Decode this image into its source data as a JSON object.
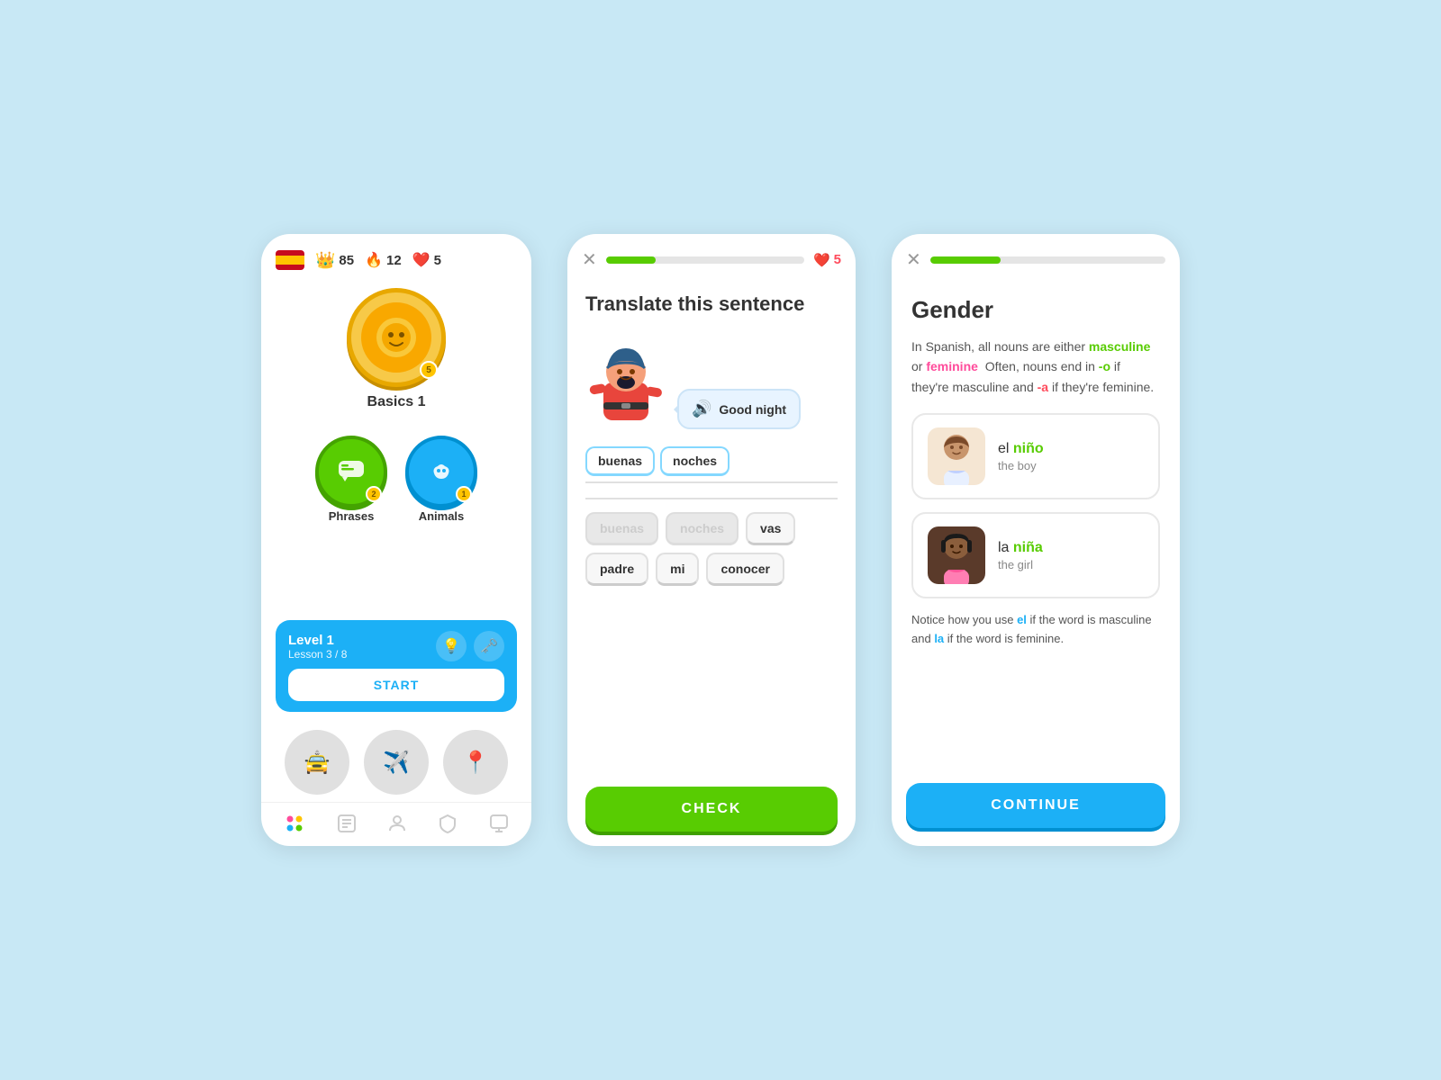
{
  "bg_color": "#c8e8f5",
  "card1": {
    "flag": "🇪🇸",
    "stats": {
      "crown_icon": "👑",
      "crown_value": "85",
      "fire_icon": "🔥",
      "fire_value": "12",
      "heart_icon": "❤️",
      "heart_value": "5"
    },
    "basics": {
      "icon": "⭐",
      "badge": "5",
      "label": "Basics 1"
    },
    "phrases": {
      "icon": "💬",
      "badge": "2",
      "label": "Phrases"
    },
    "animals": {
      "icon": "🐟",
      "badge": "1",
      "label": "Animals"
    },
    "level": {
      "title": "Level 1",
      "lesson": "Lesson 3 / 8",
      "start_label": "START"
    },
    "locked": [
      "🚖",
      "✈️",
      "📍"
    ],
    "nav_items": [
      "home",
      "book",
      "globe",
      "shield",
      "id"
    ]
  },
  "card2": {
    "progress_pct": 25,
    "lives": "5",
    "title": "Translate this sentence",
    "speech_text": "Good night",
    "answer_words": [
      "buenas",
      "noches"
    ],
    "word_bank": [
      {
        "text": "buenas",
        "used": true
      },
      {
        "text": "noches",
        "used": true
      },
      {
        "text": "vas",
        "used": false
      },
      {
        "text": "padre",
        "used": false
      },
      {
        "text": "mi",
        "used": false
      },
      {
        "text": "conocer",
        "used": false
      }
    ],
    "check_label": "CHECK"
  },
  "card3": {
    "progress_pct": 30,
    "title": "Gender",
    "description_parts": [
      {
        "text": "In Spanish, all nouns are either ",
        "style": "normal"
      },
      {
        "text": "masculine",
        "style": "green"
      },
      {
        "text": " or ",
        "style": "normal"
      },
      {
        "text": "feminine",
        "style": "pink"
      },
      {
        "text": "  Often, nouns end in ",
        "style": "normal"
      },
      {
        "text": "-o",
        "style": "green"
      },
      {
        "text": " if they're masculine and ",
        "style": "normal"
      },
      {
        "text": "-a",
        "style": "red"
      },
      {
        "text": " if they're feminine.",
        "style": "normal"
      }
    ],
    "boy_card": {
      "article": "el ",
      "word": "niño",
      "translation": "the boy"
    },
    "girl_card": {
      "article": "la ",
      "word": "niña",
      "translation": "the girl"
    },
    "note_parts": [
      {
        "text": "Notice how you use ",
        "style": "normal"
      },
      {
        "text": "el",
        "style": "blue"
      },
      {
        "text": " if the word is masculine and ",
        "style": "normal"
      },
      {
        "text": "la",
        "style": "blue"
      },
      {
        "text": " if the word is feminine.",
        "style": "normal"
      }
    ],
    "continue_label": "CONTINUE"
  }
}
